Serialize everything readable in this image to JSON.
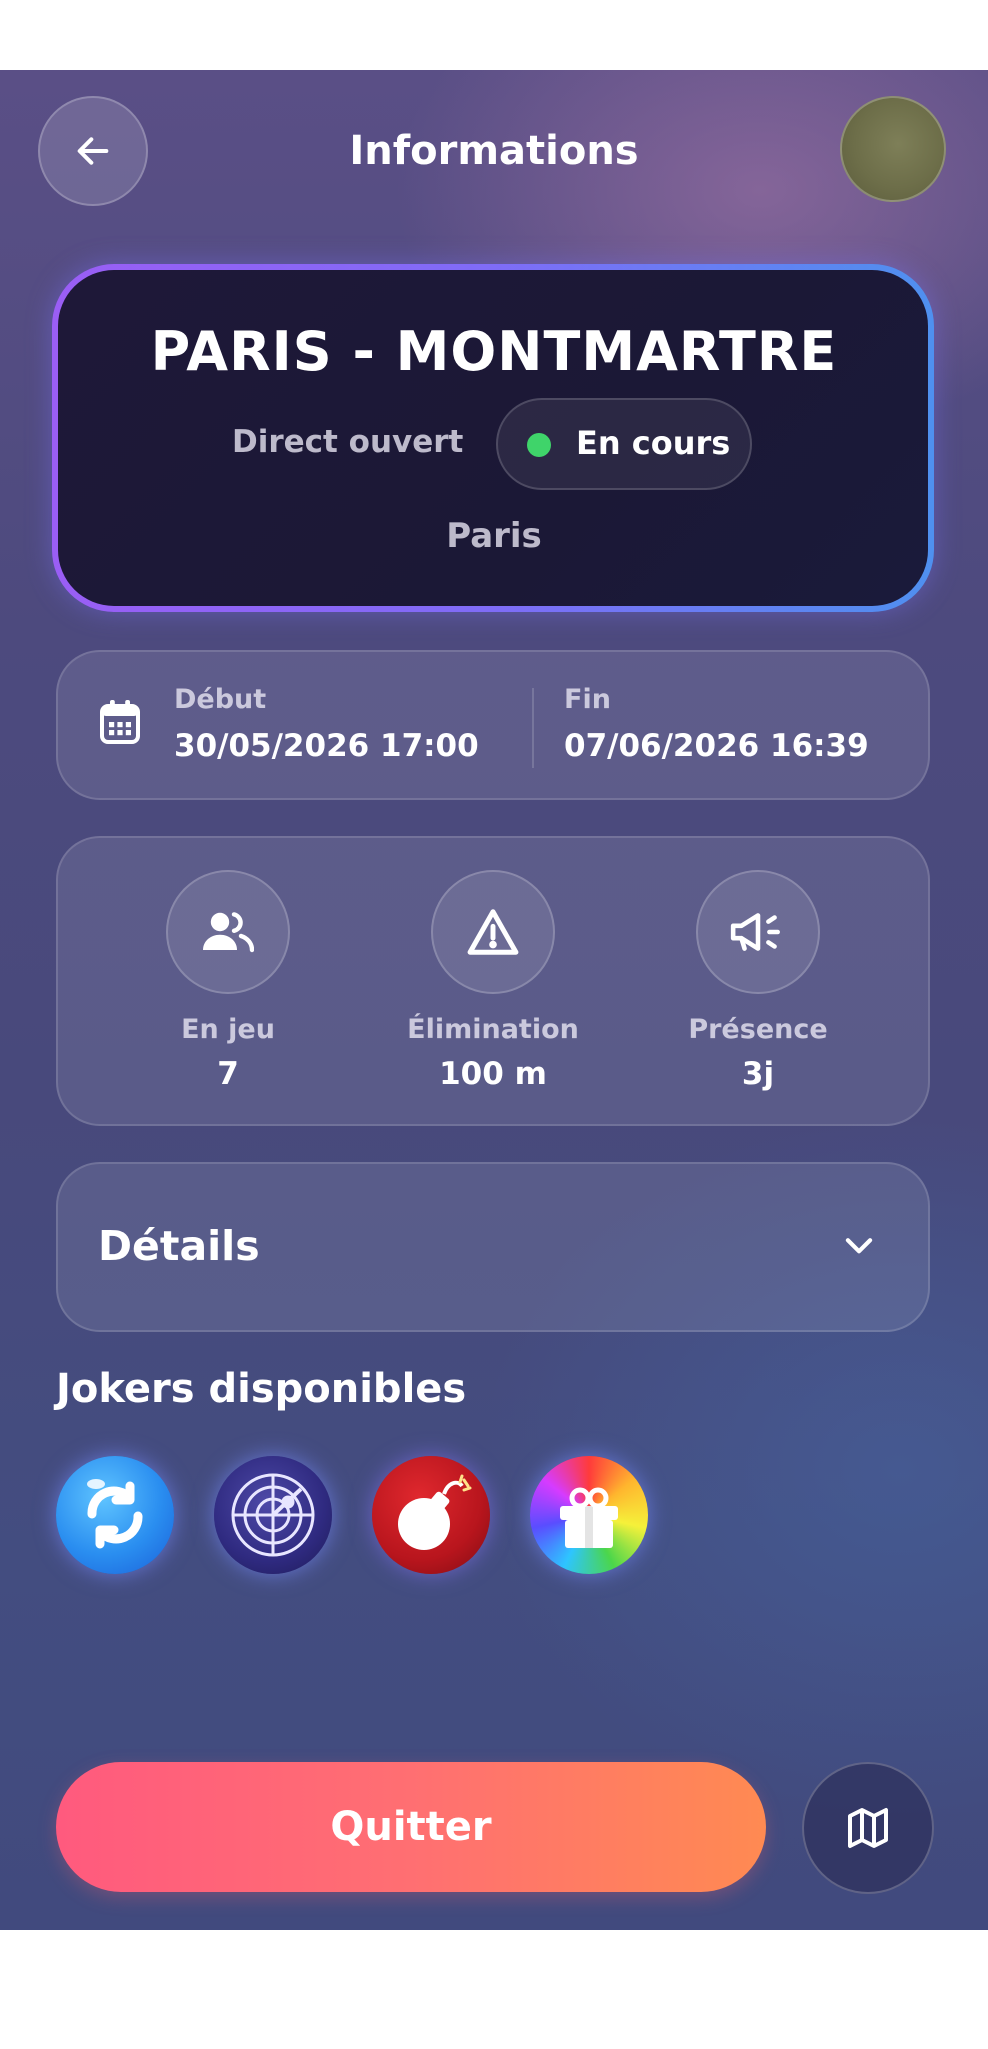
{
  "header": {
    "title": "Informations",
    "back_icon": "arrow-left-icon"
  },
  "hero": {
    "name": "PARIS - MONTMARTRE",
    "mode": "Direct ouvert",
    "status": "En cours",
    "status_color": "#3fd46a",
    "city": "Paris"
  },
  "dates": {
    "start_label": "Début",
    "start_value": "30/05/2026 17:00",
    "end_label": "Fin",
    "end_value": "07/06/2026 16:39"
  },
  "stats": [
    {
      "icon": "players-icon",
      "label": "En jeu",
      "value": "7"
    },
    {
      "icon": "warning-icon",
      "label": "Élimination",
      "value": "100 m"
    },
    {
      "icon": "megaphone-icon",
      "label": "Présence",
      "value": "3j"
    }
  ],
  "details": {
    "label": "Détails"
  },
  "jokers": {
    "title": "Jokers disponibles",
    "items": [
      "swap-joker-icon",
      "radar-joker-icon",
      "bomb-joker-icon",
      "gift-joker-icon"
    ]
  },
  "footer": {
    "quit_label": "Quitter",
    "quit_gradient": [
      "#ff5a7e",
      "#ff8a52"
    ],
    "map_icon": "map-icon"
  }
}
